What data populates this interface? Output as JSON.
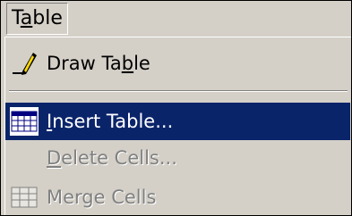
{
  "menubar": {
    "title_pre": "T",
    "title_accel": "a",
    "title_post": "ble"
  },
  "menu": {
    "draw_table": {
      "pre": "Draw Ta",
      "accel": "b",
      "post": "le",
      "icon": "pencil-icon",
      "enabled": true
    },
    "insert_table": {
      "pre": "",
      "accel": "I",
      "post": "nsert Table...",
      "icon": "insert-table-icon",
      "enabled": true,
      "highlighted": true
    },
    "delete_cells": {
      "pre": "",
      "accel": "D",
      "post": "elete Cells...",
      "enabled": false
    },
    "merge_cells": {
      "pre": "",
      "accel": "",
      "post": "Merge Cells",
      "icon": "merge-cells-icon",
      "enabled": false
    }
  },
  "colors": {
    "menu_face": "#d4d0c8",
    "highlight": "#0a246a",
    "highlight_text": "#ffffff",
    "disabled_text": "#808080"
  }
}
